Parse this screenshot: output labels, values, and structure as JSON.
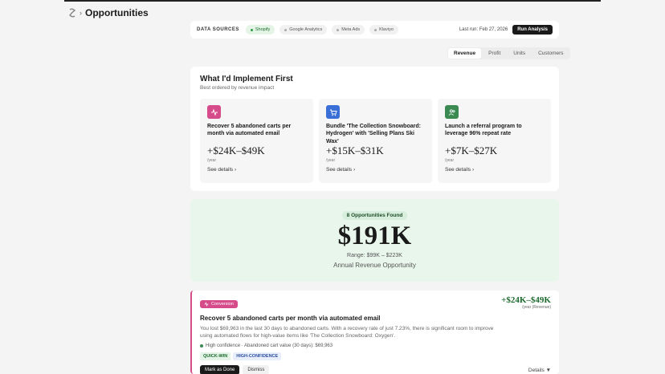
{
  "header": {
    "title": "Opportunities",
    "separator": "›"
  },
  "sources": {
    "label": "DATA SOURCES",
    "items": [
      {
        "label": "Shopify",
        "active": true
      },
      {
        "label": "Google Analytics",
        "active": false
      },
      {
        "label": "Meta Ads",
        "active": false
      },
      {
        "label": "Klaviyo",
        "active": false
      }
    ],
    "last_run": "Last run: Feb 27, 2026",
    "run_button": "Run Analysis"
  },
  "tabs": [
    {
      "label": "Revenue",
      "active": true
    },
    {
      "label": "Profit",
      "active": false
    },
    {
      "label": "Units",
      "active": false
    },
    {
      "label": "Customers",
      "active": false
    }
  ],
  "implement": {
    "title": "What I'd Implement First",
    "subtitle": "Best ordered by revenue impact",
    "cards": [
      {
        "icon": "activity-icon",
        "icon_bg": "#d64b8a",
        "title": "Recover 5 abandoned carts per month via automated email",
        "value": "+$24K–$49K",
        "unit": "/year",
        "link": "See details ›"
      },
      {
        "icon": "cart-icon",
        "icon_bg": "#3b6fd8",
        "title": "Bundle 'The Collection Snowboard: Hydrogen' with 'Selling Plans Ski Wax'",
        "value": "+$15K–$31K",
        "unit": "/year",
        "link": "See details ›"
      },
      {
        "icon": "users-icon",
        "icon_bg": "#3a8a52",
        "title": "Launch a referral program to leverage 96% repeat rate",
        "value": "+$7K–$27K",
        "unit": "/year",
        "link": "See details ›"
      }
    ]
  },
  "summary": {
    "found": "8 Opportunities Found",
    "total": "$191K",
    "range": "Range:  $99K  –  $223K",
    "label": "Annual Revenue Opportunity"
  },
  "detail": {
    "category": "Conversion",
    "value": "+$24K–$49K",
    "unit": "/year (Revenue)",
    "title": "Recover 5 abandoned carts per month via automated email",
    "description": "You lost $69,963 in the last 30 days to abandoned carts. With a recovery rate of just 7.23%, there is significant room to improve using automated flows for high-value items like 'The Collection Snowboard: Oxygen'.",
    "confidence": "High confidence · Abandoned cart value (30 days): $69,963",
    "tags": [
      "QUICK-WIN",
      "HIGH-CONFIDENCE"
    ],
    "done_button": "Mark as Done",
    "dismiss_button": "Dismiss",
    "details_toggle": "Details ▼"
  },
  "colors": {
    "accent_pink": "#d64b8a",
    "accent_green": "#1d6b2e",
    "summary_bg": "#e9f6ec"
  }
}
